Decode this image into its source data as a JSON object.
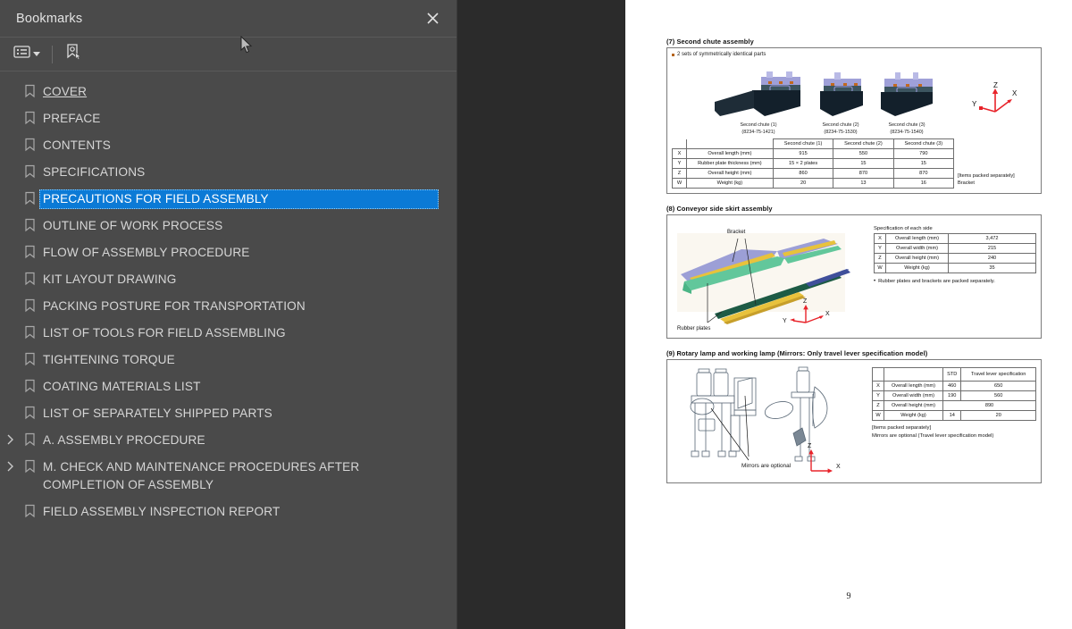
{
  "sidebar": {
    "title": "Bookmarks",
    "close_icon": "close-icon",
    "toolbar": {
      "options_label": "bookmark-options",
      "new_bookmark_label": "new-bookmark"
    },
    "items": [
      {
        "label": "COVER",
        "expandable": false,
        "selected": false,
        "underline": true
      },
      {
        "label": "PREFACE",
        "expandable": false,
        "selected": false
      },
      {
        "label": "CONTENTS",
        "expandable": false,
        "selected": false
      },
      {
        "label": "SPECIFICATIONS",
        "expandable": false,
        "selected": false
      },
      {
        "label": "PRECAUTIONS FOR FIELD ASSEMBLY",
        "expandable": false,
        "selected": true
      },
      {
        "label": "OUTLINE OF WORK PROCESS",
        "expandable": false,
        "selected": false
      },
      {
        "label": "FLOW OF ASSEMBLY PROCEDURE",
        "expandable": false,
        "selected": false
      },
      {
        "label": "KIT LAYOUT DRAWING",
        "expandable": false,
        "selected": false
      },
      {
        "label": "PACKING POSTURE FOR TRANSPORTATION",
        "expandable": false,
        "selected": false
      },
      {
        "label": "LIST OF TOOLS FOR FIELD ASSEMBLING",
        "expandable": false,
        "selected": false
      },
      {
        "label": "TIGHTENING TORQUE",
        "expandable": false,
        "selected": false
      },
      {
        "label": "COATING MATERIALS LIST",
        "expandable": false,
        "selected": false
      },
      {
        "label": "LIST OF SEPARATELY SHIPPED PARTS",
        "expandable": false,
        "selected": false
      },
      {
        "label": "A. ASSEMBLY PROCEDURE",
        "expandable": true,
        "selected": false
      },
      {
        "label": "M. CHECK AND MAINTENANCE PROCEDURES AFTER COMPLETION OF ASSEMBLY",
        "expandable": true,
        "selected": false
      },
      {
        "label": "FIELD ASSEMBLY INSPECTION REPORT",
        "expandable": false,
        "selected": false
      }
    ],
    "selection_color": "#0b7ad6",
    "panel_color": "#4a4a4a"
  },
  "viewer": {
    "background_color": "#2b2b2b",
    "page_number": "9",
    "collapse_handle": "collapse-sidebar"
  },
  "document": {
    "section7": {
      "title": "(7) Second chute assembly",
      "note": "2 sets of symmetrically identical parts",
      "figures": [
        {
          "caption": "Second chute (1)",
          "part_no": "(8234-75-1421)"
        },
        {
          "caption": "Second chute (2)",
          "part_no": "(8234-75-1530)"
        },
        {
          "caption": "Second chute (3)",
          "part_no": "(8234-75-1540)"
        }
      ],
      "axes": {
        "x": "X",
        "y": "Y",
        "z": "Z"
      },
      "table": {
        "headers": [
          "",
          "",
          "Second chute (1)",
          "Second chute (2)",
          "Second chute (3)"
        ],
        "rows": [
          {
            "axis": "X",
            "label": "Overall length (mm)",
            "values": [
              "915",
              "550",
              "790"
            ]
          },
          {
            "axis": "Y",
            "label": "Rubber plate thickness (mm)",
            "values": [
              "15 × 2 plates",
              "15",
              "15"
            ]
          },
          {
            "axis": "Z",
            "label": "Overall height (mm)",
            "values": [
              "860",
              "870",
              "870"
            ]
          },
          {
            "axis": "W",
            "label": "Weight (kg)",
            "values": [
              "20",
              "13",
              "16"
            ]
          }
        ]
      },
      "side_note_title": "[Items packed separately]",
      "side_note_body": "Bracket"
    },
    "section8": {
      "title": "(8) Conveyor side skirt assembly",
      "labels": {
        "bracket": "Bracket",
        "rubber_plates": "Rubber plates"
      },
      "axes": {
        "x": "X",
        "y": "Y",
        "z": "Z"
      },
      "spec_title": "Specification of each side",
      "table": {
        "rows": [
          {
            "axis": "X",
            "label": "Overall length (mm)",
            "value": "3,472"
          },
          {
            "axis": "Y",
            "label": "Overall width (mm)",
            "value": "215"
          },
          {
            "axis": "Z",
            "label": "Overall height (mm)",
            "value": "240"
          },
          {
            "axis": "W",
            "label": "Weight (kg)",
            "value": "35"
          }
        ]
      },
      "note": "Rubber plates and brackets are packed separately."
    },
    "section9": {
      "title": "(9) Rotary lamp and working lamp (Mirrors: Only travel lever specification model)",
      "figure_label": "Mirrors are optional",
      "axes": {
        "x": "X",
        "z": "Z"
      },
      "table": {
        "col_headers": [
          "STD",
          "Travel lever specification"
        ],
        "rows": [
          {
            "axis": "X",
            "label": "Overall length (mm)",
            "std": "460",
            "travel": "650",
            "merged": false
          },
          {
            "axis": "Y",
            "label": "Overall width (mm)",
            "std": "190",
            "travel": "560",
            "merged": false
          },
          {
            "axis": "Z",
            "label": "Overall height (mm)",
            "std": "890",
            "travel": "",
            "merged": true
          },
          {
            "axis": "W",
            "label": "Weight (kg)",
            "std": "14",
            "travel": "20",
            "merged": false
          }
        ]
      },
      "note_title": "[Items packed separately]",
      "note_body": "Mirrors are optional (Travel lever specification model)"
    }
  }
}
